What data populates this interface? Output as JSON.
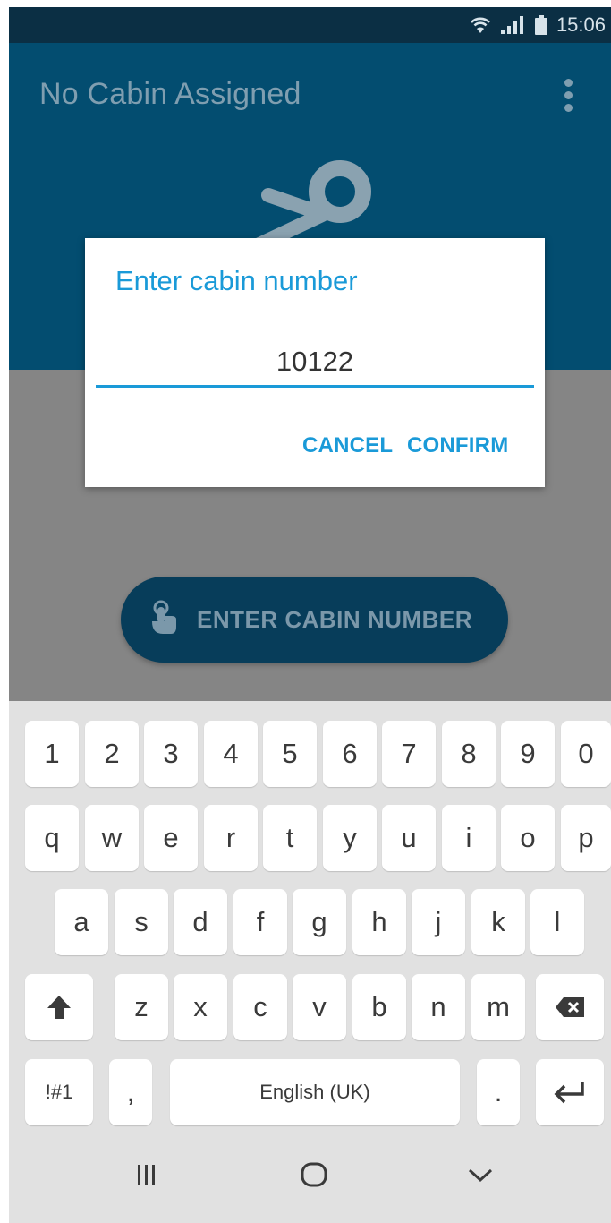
{
  "status_bar": {
    "time": "15:06"
  },
  "app_bar": {
    "title": "No Cabin Assigned"
  },
  "dialog": {
    "title": "Enter cabin number",
    "input_value": "10122",
    "cancel_label": "CANCEL",
    "confirm_label": "CONFIRM"
  },
  "main": {
    "enter_button_label": "ENTER CABIN NUMBER"
  },
  "keyboard": {
    "row1": [
      "1",
      "2",
      "3",
      "4",
      "5",
      "6",
      "7",
      "8",
      "9",
      "0"
    ],
    "row2": [
      "q",
      "w",
      "e",
      "r",
      "t",
      "y",
      "u",
      "i",
      "o",
      "p"
    ],
    "row3": [
      "a",
      "s",
      "d",
      "f",
      "g",
      "h",
      "j",
      "k",
      "l"
    ],
    "row4": [
      "z",
      "x",
      "c",
      "v",
      "b",
      "n",
      "m"
    ],
    "symbols_label": "!#1",
    "comma_label": ",",
    "space_label": "English (UK)",
    "period_label": "."
  },
  "colors": {
    "accent": "#1a9ad8",
    "app_bar": "#034d70",
    "status_bar": "#0b2f44",
    "scrim_background": "#858585",
    "keyboard_bg": "#e1e1e1"
  },
  "icons": [
    "wifi-icon",
    "signal-icon",
    "battery-icon",
    "overflow-menu-icon",
    "anchor-icon",
    "touch-icon",
    "shift-icon",
    "backspace-icon",
    "enter-icon",
    "recents-icon",
    "home-icon",
    "back-icon"
  ]
}
